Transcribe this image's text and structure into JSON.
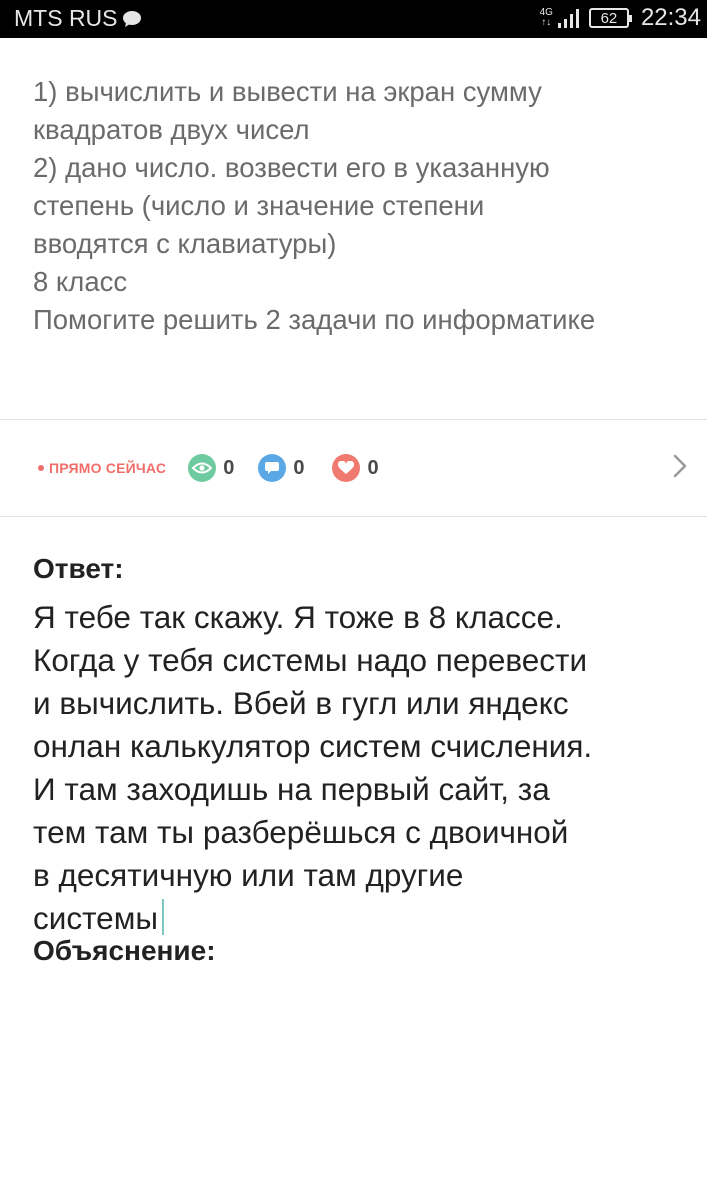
{
  "status_bar": {
    "carrier": "MTS RUS",
    "network_type_top": "4G",
    "network_type_bottom": "↑↓",
    "battery_level": "62",
    "time": "22:34",
    "icons": [
      "chat-bubble-icon",
      "signal-icon",
      "battery-icon"
    ]
  },
  "question": {
    "lines": [
      "1) вычислить и вывести на экран сумму",
      "квадратов двух чисел",
      "2) дано число. возвести его в указанную",
      "степень (число и значение степени",
      "вводятся с клавиатуры)",
      "8 класс",
      "Помогите решить 2 задачи по информатике"
    ]
  },
  "actions": {
    "live_label": "ПРЯМО СЕЙЧАС",
    "views_count": "0",
    "comments_count": "0",
    "likes_count": "0",
    "icons": [
      "eye-icon",
      "comment-icon",
      "heart-icon",
      "chevron-right-icon"
    ],
    "colors": {
      "live": "#f06e6a",
      "views": "#6ecb9f",
      "comments": "#5aa8e6",
      "likes": "#f07a70"
    }
  },
  "answer": {
    "heading": "Ответ:",
    "lines": [
      "Я тебе так скажу. Я тоже в 8 классе.",
      "Когда у тебя системы надо перевести",
      "и вычислить. Вбей в гугл или яндекс",
      "онлан калькулятор систем счисления.",
      "И там заходишь на первый сайт, за",
      "тем там ты разберёшься с двоичной",
      "в десятичную или там другие",
      "системы"
    ],
    "explanation_heading": "Объяснение:"
  }
}
